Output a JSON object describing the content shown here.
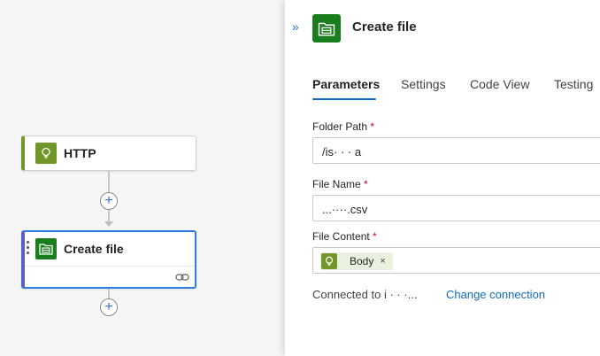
{
  "canvas": {
    "nodes": [
      {
        "title": "HTTP",
        "icon": "http-lightbulb-icon",
        "accent": "#709727"
      },
      {
        "title": "Create file",
        "icon": "file-folder-icon",
        "accent": "#1a7d1e"
      }
    ],
    "add_step_symbol": "+"
  },
  "panel": {
    "collapse_symbol": "»",
    "title": "Create file",
    "icon": "file-folder-icon",
    "tabs": [
      {
        "label": "Parameters",
        "active": true
      },
      {
        "label": "Settings",
        "active": false
      },
      {
        "label": "Code View",
        "active": false
      },
      {
        "label": "Testing",
        "active": false
      }
    ],
    "fields": {
      "folder_path": {
        "label": "Folder Path",
        "required_marker": "*",
        "value": "/is·  ·  ·   a"
      },
      "file_name": {
        "label": "File Name",
        "required_marker": "*",
        "value": "...····.csv"
      },
      "file_content": {
        "label": "File Content",
        "required_marker": "*",
        "token_label": "Body",
        "token_remove": "×"
      }
    },
    "connection": {
      "text": "Connected to i  ·  ·  ·...",
      "change_link": "Change connection"
    }
  },
  "colors": {
    "accent_blue": "#0f6cbd",
    "http_green": "#709727",
    "file_green": "#1a7d1e",
    "required_red": "#c50f1f"
  }
}
